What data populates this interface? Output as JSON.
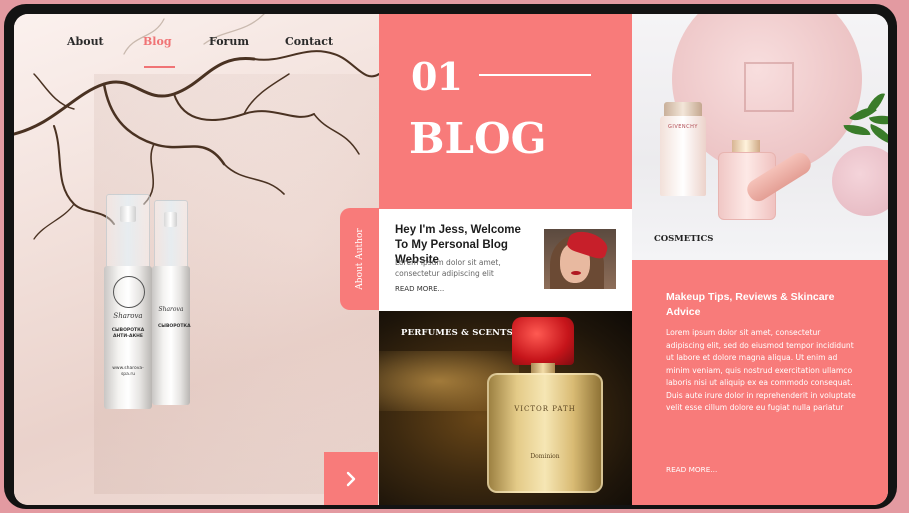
{
  "nav": {
    "items": [
      "About",
      "Blog",
      "Forum",
      "Contact"
    ],
    "active": "Blog"
  },
  "hero": {
    "bottle_brand": "Sharova",
    "bottle1_label": "СЫВОРОТКА АНТИ-АКНЕ",
    "bottle2_label": "СЫВОРОТКА",
    "bottle_url": "www.sharova-spa.ru"
  },
  "blog": {
    "number": "01",
    "title": "BLOG"
  },
  "author": {
    "tab_label": "About Author",
    "heading": "Hey I'm Jess, Welcome To My Personal Blog Website",
    "body": "Lorem ipsum dolor sit amet, consectetur adipiscing elit",
    "read_more": "READ MORE..."
  },
  "perfumes": {
    "label": "PERFUMES & SCENTS",
    "brand": "VICTOR PATH",
    "product": "Dominion"
  },
  "cosmetics": {
    "label": "COSMETICS",
    "tube_brand": "GIVENCHY"
  },
  "makeup": {
    "title": "Makeup Tips, Reviews & Skincare Advice",
    "body": "Lorem ipsum dolor sit amet, consectetur adipiscing elit, sed do eiusmod tempor incididunt ut labore et dolore magna aliqua. Ut enim ad minim veniam, quis nostrud exercitation ullamco laboris nisi ut aliquip ex ea commodo consequat. Duis aute irure dolor in reprehenderit in voluptate velit esse cillum dolore eu fugiat nulla pariatur",
    "read_more": "READ MORE..."
  },
  "colors": {
    "accent": "#f87b7a",
    "frame": "#131313",
    "background": "#e39aa1"
  },
  "icons": {
    "next": "chevron-right-icon"
  }
}
